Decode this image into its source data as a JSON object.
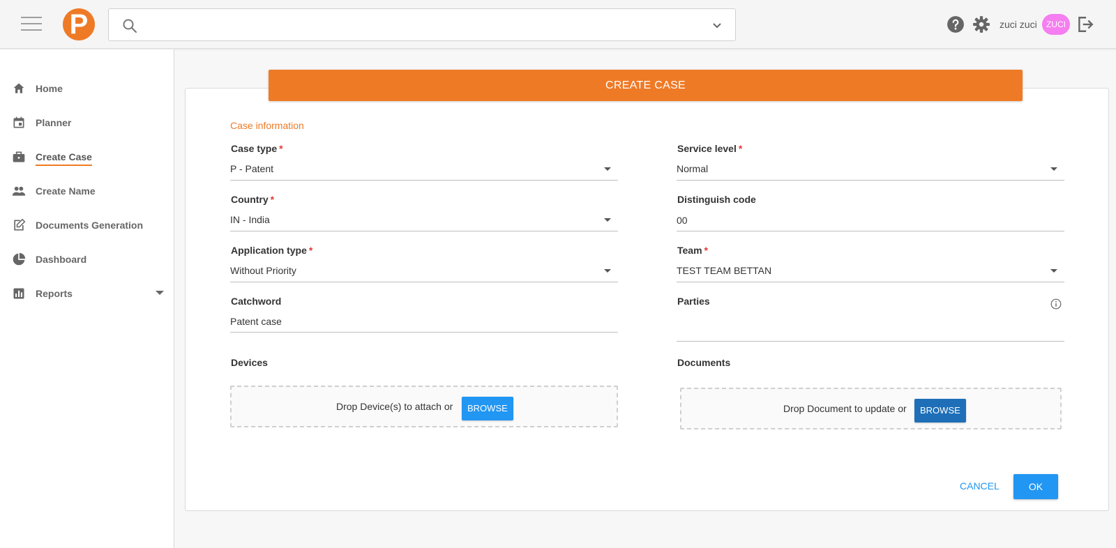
{
  "header": {
    "logo_letter": "P",
    "search_placeholder": "",
    "user_name": "zuci zuci",
    "avatar_text": "ZUCI"
  },
  "sidebar": {
    "items": [
      {
        "label": "Home",
        "icon": "home-icon"
      },
      {
        "label": "Planner",
        "icon": "calendar-icon"
      },
      {
        "label": "Create Case",
        "icon": "briefcase-icon",
        "active": true
      },
      {
        "label": "Create Name",
        "icon": "people-icon"
      },
      {
        "label": "Documents Generation",
        "icon": "edit-document-icon"
      },
      {
        "label": "Dashboard",
        "icon": "pie-chart-icon"
      },
      {
        "label": "Reports",
        "icon": "bar-chart-icon",
        "has_submenu": true
      }
    ]
  },
  "form": {
    "title": "CREATE CASE",
    "section_title": "Case information",
    "case_type": {
      "label": "Case type",
      "value": "P - Patent"
    },
    "country": {
      "label": "Country",
      "value": "IN - India"
    },
    "application_type": {
      "label": "Application type",
      "value": "Without Priority"
    },
    "catchword": {
      "label": "Catchword",
      "value": "Patent case"
    },
    "service_level": {
      "label": "Service level",
      "value": "Normal"
    },
    "distinguish_code": {
      "label": "Distinguish code",
      "value": "00"
    },
    "team": {
      "label": "Team",
      "value": "TEST TEAM BETTAN"
    },
    "parties": {
      "label": "Parties",
      "value": ""
    },
    "devices": {
      "label": "Devices",
      "drop_text": "Drop Device(s) to attach or",
      "browse": "BROWSE"
    },
    "documents": {
      "label": "Documents",
      "drop_text": "Drop Document to update or",
      "browse": "BROWSE"
    },
    "required_mark": "*",
    "cancel": "CANCEL",
    "ok": "OK"
  },
  "colors": {
    "accent": "#ef7a26",
    "primary": "#2196f3",
    "browse_dark": "#1e6fb8",
    "required": "#e53935",
    "avatar": "#f57ef0"
  }
}
